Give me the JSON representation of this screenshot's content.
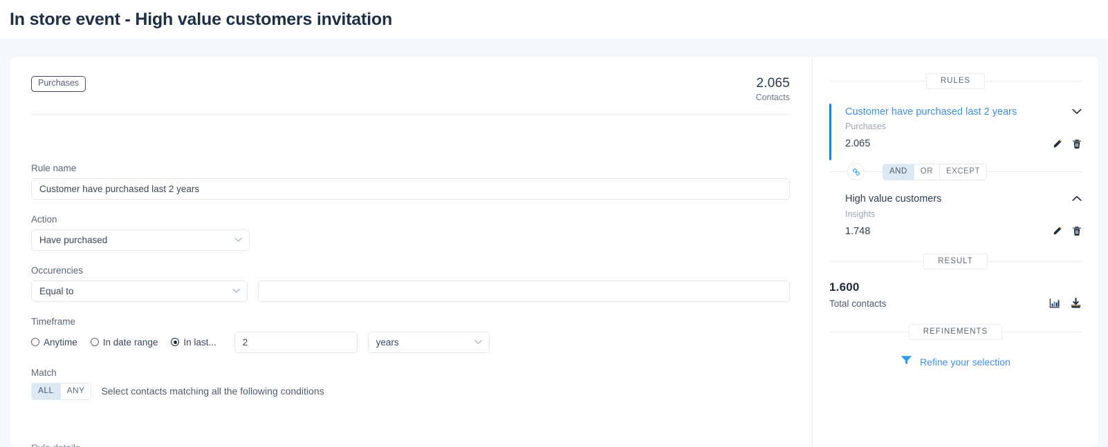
{
  "header": {
    "title": "In store event - High value customers invitation"
  },
  "builder": {
    "source_chip": "Purchases",
    "contacts_count": "2.065",
    "contacts_label": "Contacts",
    "rule_name": {
      "label": "Rule name",
      "value": "Customer have purchased last 2 years",
      "placeholder": ""
    },
    "action": {
      "label": "Action",
      "value": "Have purchased"
    },
    "occurencies": {
      "label": "Occurencies",
      "operator": "Equal to",
      "value": "",
      "placeholder": ""
    },
    "timeframe": {
      "label": "Timeframe",
      "options": [
        {
          "label": "Anytime",
          "selected": false
        },
        {
          "label": "In date range",
          "selected": false
        },
        {
          "label": "In last...",
          "selected": true
        }
      ],
      "amount": "2",
      "unit": "years"
    },
    "match": {
      "label": "Match",
      "options": [
        {
          "label": "ALL",
          "selected": true
        },
        {
          "label": "ANY",
          "selected": false
        }
      ],
      "description": "Select contacts matching all the following conditions"
    },
    "cutoff_text": "Rule details"
  },
  "rules_panel": {
    "rules_divider": "RULES",
    "rules": [
      {
        "name": "Customer have purchased last 2 years",
        "source": "Purchases",
        "count": "2.065",
        "accent_color": "#0b87ea",
        "expanded": false,
        "chevron": "chevron-down-icon"
      },
      {
        "name": "High value customers",
        "source": "Insights",
        "count": "1.748",
        "accent_color": "",
        "expanded": true,
        "chevron": "chevron-up-icon"
      }
    ],
    "connector": {
      "icon": "link-icon",
      "operators": [
        {
          "label": "AND",
          "selected": true
        },
        {
          "label": "OR",
          "selected": false
        },
        {
          "label": "EXCEPT",
          "selected": false
        }
      ]
    },
    "result": {
      "divider": "RESULT",
      "value": "1.600",
      "label": "Total contacts",
      "actions": [
        "chart-icon",
        "download-icon"
      ]
    },
    "refinements": {
      "divider": "REFINEMENTS",
      "link_text": "Refine your selection",
      "link_color": "#2f9bf0"
    }
  }
}
